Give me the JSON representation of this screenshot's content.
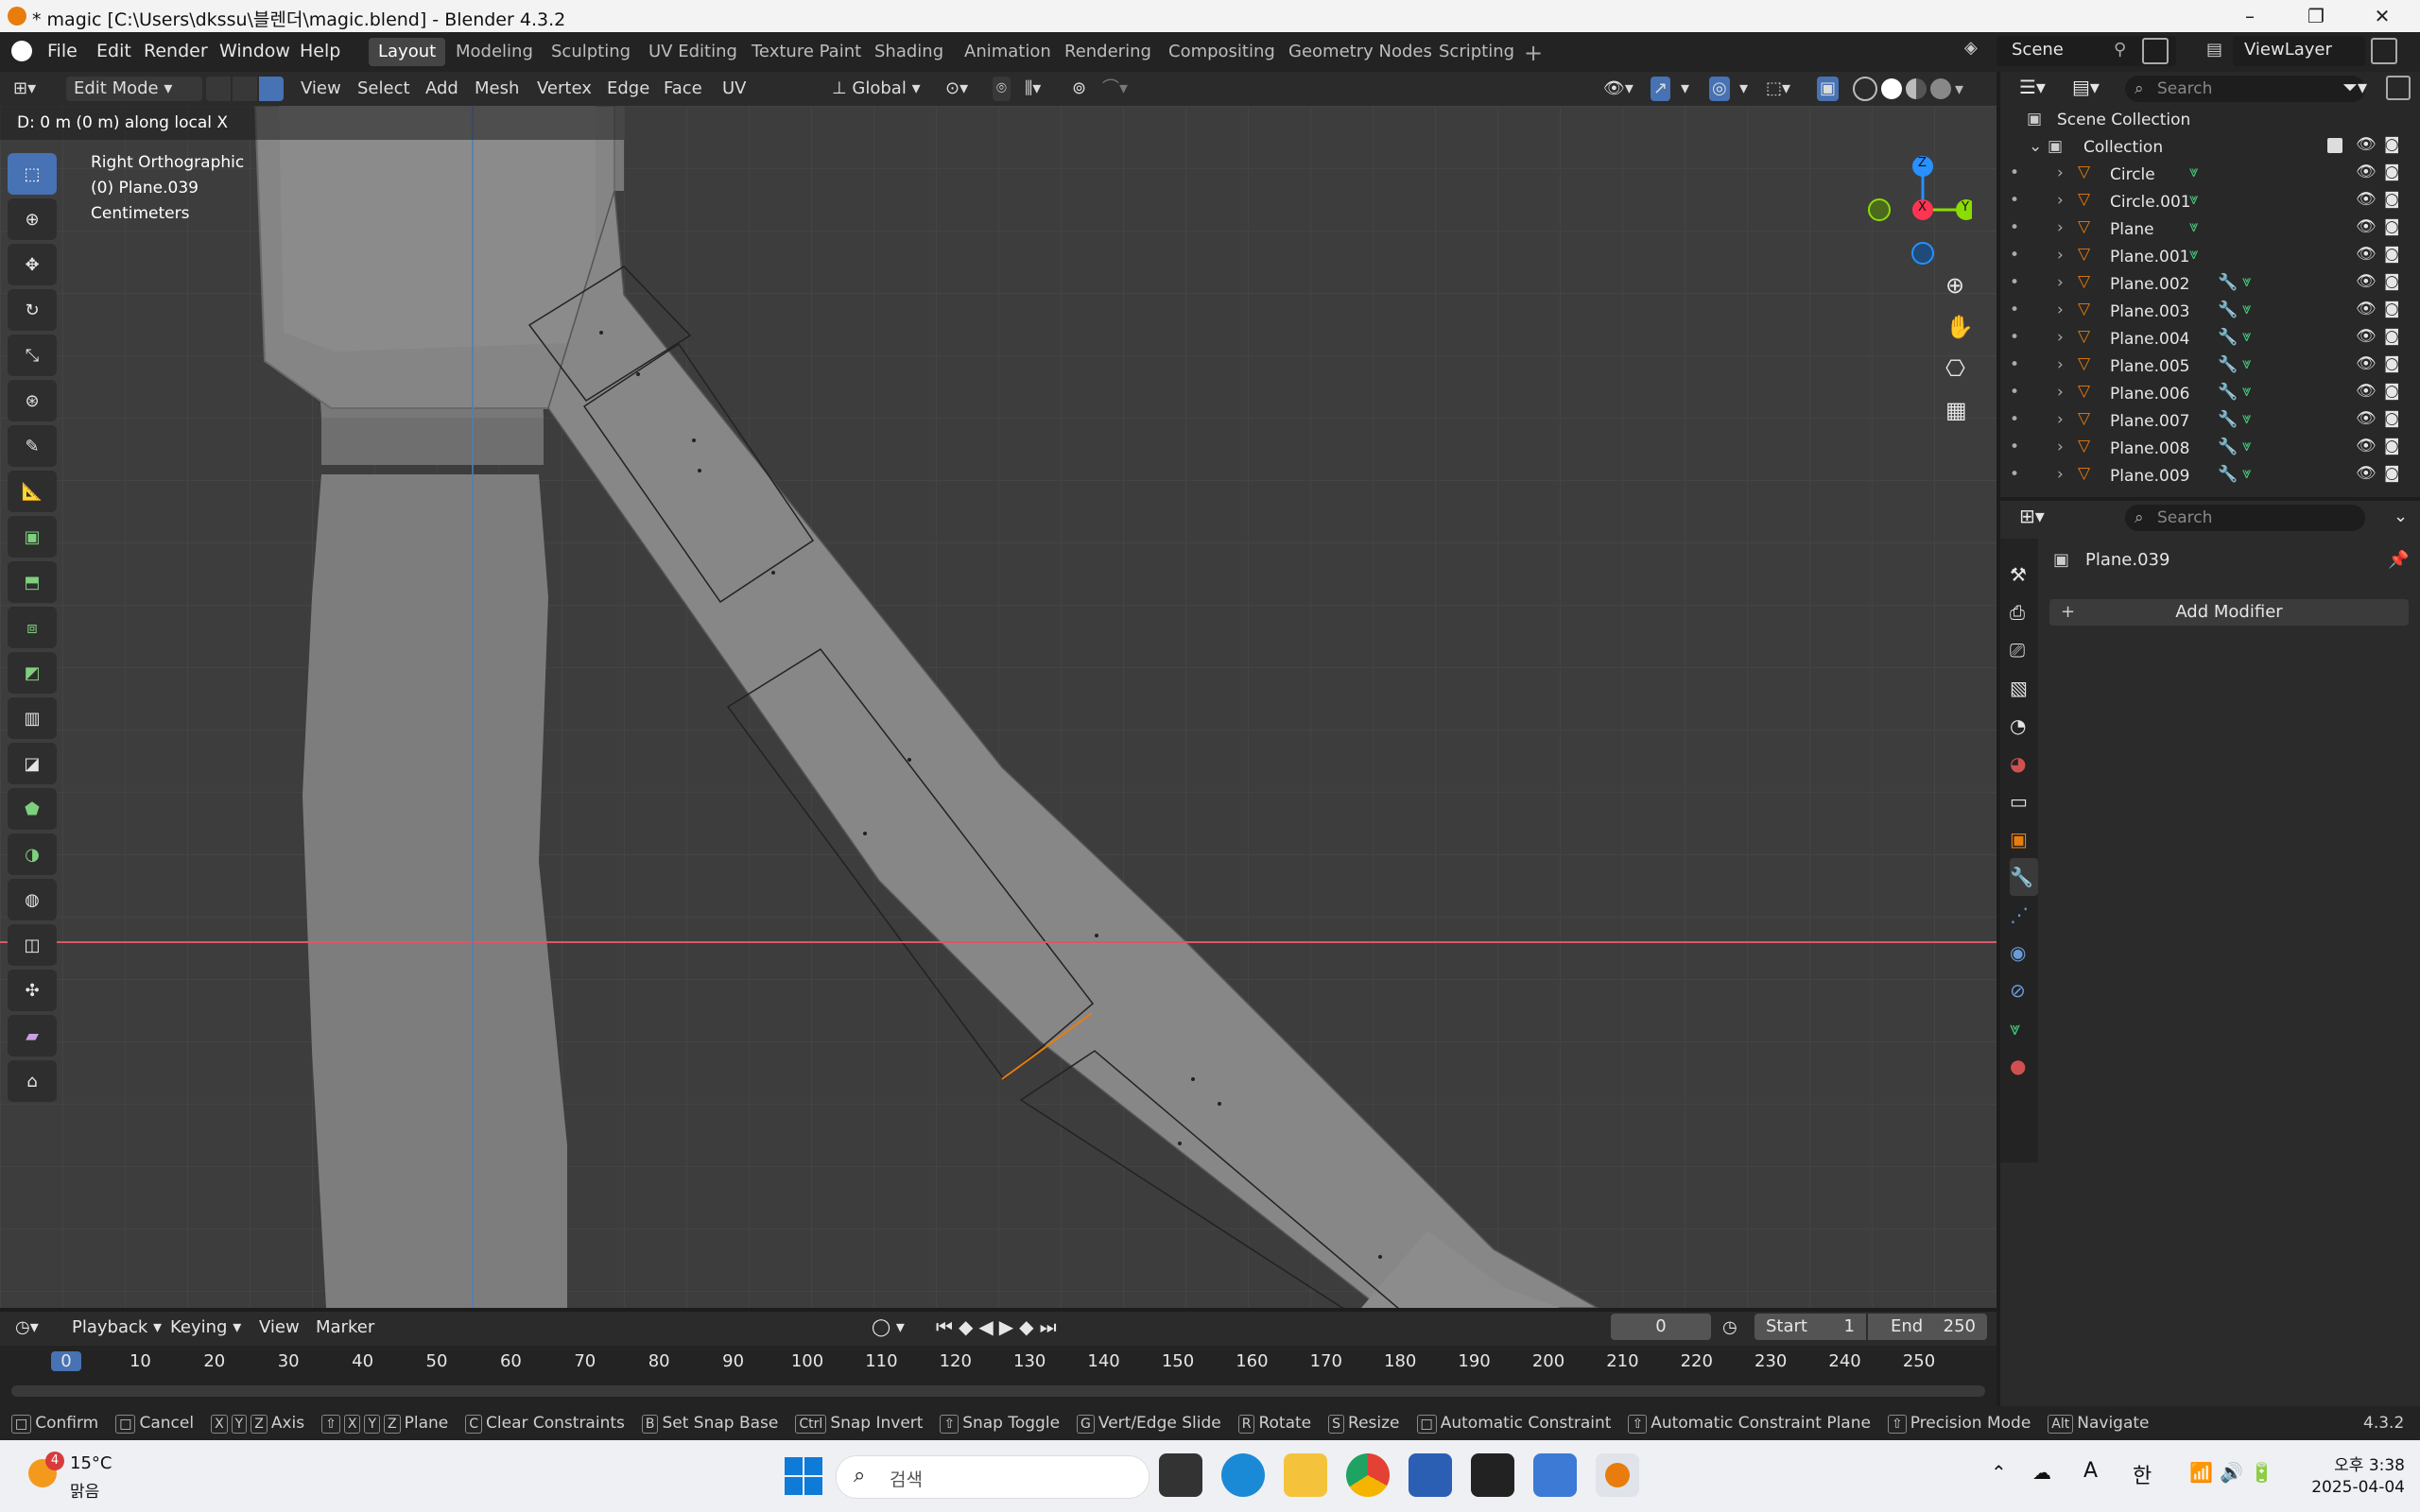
{
  "window": {
    "title": "* magic [C:\\Users\\dkssu\\블렌더\\magic.blend] - Blender 4.3.2"
  },
  "menu": [
    "File",
    "Edit",
    "Render",
    "Window",
    "Help"
  ],
  "workspaces": [
    "Layout",
    "Modeling",
    "Sculpting",
    "UV Editing",
    "Texture Paint",
    "Shading",
    "Animation",
    "Rendering",
    "Compositing",
    "Geometry Nodes",
    "Scripting"
  ],
  "active_workspace": "Layout",
  "scene": {
    "label": "Scene",
    "view_layer": "ViewLayer"
  },
  "header": {
    "mode": "Edit Mode",
    "menus": [
      "View",
      "Select",
      "Add",
      "Mesh",
      "Vertex",
      "Edge",
      "Face",
      "UV"
    ],
    "transform_orientation": "Global"
  },
  "viewport": {
    "operator_hint": "D: 0 m (0 m) along local X",
    "view_name": "Right Orthographic",
    "object_name": "(0) Plane.039",
    "units": "Centimeters",
    "gizmo": {
      "z": "Z",
      "x": "X",
      "y": "Y"
    }
  },
  "outliner": {
    "search_placeholder": "Search",
    "root": "Scene Collection",
    "collection": "Collection",
    "items": [
      "Circle",
      "Circle.001",
      "Plane",
      "Plane.001",
      "Plane.002",
      "Plane.003",
      "Plane.004",
      "Plane.005",
      "Plane.006",
      "Plane.007",
      "Plane.008",
      "Plane.009"
    ]
  },
  "properties": {
    "search_placeholder": "Search",
    "object": "Plane.039",
    "add_modifier": "Add Modifier"
  },
  "timeline": {
    "menus": [
      "Playback",
      "Keying",
      "View",
      "Marker"
    ],
    "current_frame": "0",
    "start_label": "Start",
    "start": "1",
    "end_label": "End",
    "end": "250",
    "ticks": [
      "0",
      "10",
      "20",
      "30",
      "40",
      "50",
      "60",
      "70",
      "80",
      "90",
      "100",
      "110",
      "120",
      "130",
      "140",
      "150",
      "160",
      "170",
      "180",
      "190",
      "200",
      "210",
      "220",
      "230",
      "240",
      "250"
    ]
  },
  "status": {
    "items": [
      {
        "key": "",
        "label": "Confirm"
      },
      {
        "key": "",
        "label": "Cancel"
      },
      {
        "key": "X Y Z",
        "label": "Axis"
      },
      {
        "key": "⇧ X Y Z",
        "label": "Plane"
      },
      {
        "key": "C",
        "label": "Clear Constraints"
      },
      {
        "key": "B",
        "label": "Set Snap Base"
      },
      {
        "key": "Ctrl",
        "label": "Snap Invert"
      },
      {
        "key": "⇧",
        "label": "Snap Toggle"
      },
      {
        "key": "G",
        "label": "Vert/Edge Slide"
      },
      {
        "key": "R",
        "label": "Rotate"
      },
      {
        "key": "S",
        "label": "Resize"
      },
      {
        "key": "",
        "label": "Automatic Constraint"
      },
      {
        "key": "⇧",
        "label": "Automatic Constraint Plane"
      },
      {
        "key": "⇧",
        "label": "Precision Mode"
      },
      {
        "key": "Alt",
        "label": "Navigate"
      }
    ],
    "version": "4.3.2"
  },
  "taskbar": {
    "weather_temp": "15°C",
    "weather_desc": "맑음",
    "weather_badge": "4",
    "search_placeholder": "검색",
    "ime_a": "A",
    "ime_lang": "한",
    "time": "오후 3:38",
    "date": "2025-04-04"
  },
  "colors": {
    "accent": "#4772b3",
    "axis_x": "#ff3352",
    "axis_y": "#8bdc00",
    "axis_z": "#2890ff",
    "object_orange": "#e87d0d",
    "mesh_green": "#45c97a"
  }
}
